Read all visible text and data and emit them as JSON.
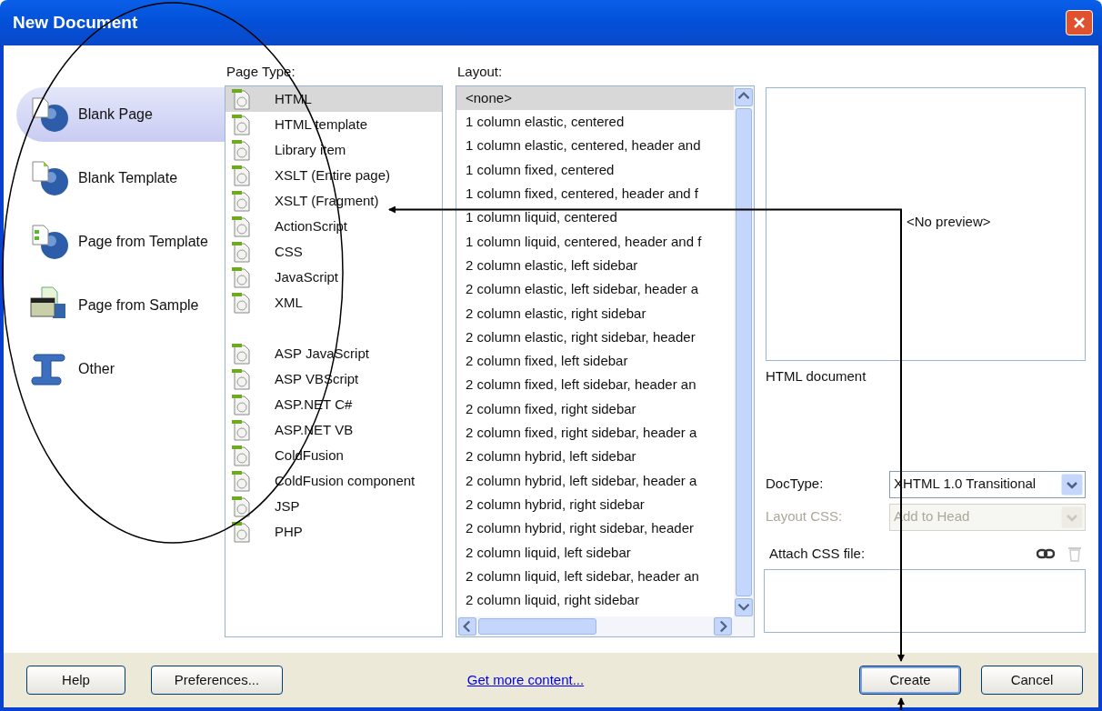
{
  "window": {
    "title": "New Document"
  },
  "categories": [
    {
      "label": "Blank Page",
      "selected": true,
      "kind": "blank-page"
    },
    {
      "label": "Blank Template",
      "selected": false,
      "kind": "blank-template"
    },
    {
      "label": "Page from Template",
      "selected": false,
      "kind": "page-template"
    },
    {
      "label": "Page from Sample",
      "selected": false,
      "kind": "page-sample"
    },
    {
      "label": "Other",
      "selected": false,
      "kind": "other"
    }
  ],
  "page_type": {
    "label": "Page Type:",
    "groups": [
      {
        "items": [
          {
            "label": "HTML",
            "selected": true
          },
          {
            "label": "HTML template",
            "selected": false
          },
          {
            "label": "Library item",
            "selected": false
          },
          {
            "label": "XSLT (Entire page)",
            "selected": false
          },
          {
            "label": "XSLT (Fragment)",
            "selected": false
          },
          {
            "label": "ActionScript",
            "selected": false
          },
          {
            "label": "CSS",
            "selected": false
          },
          {
            "label": "JavaScript",
            "selected": false
          },
          {
            "label": "XML",
            "selected": false
          }
        ]
      },
      {
        "items": [
          {
            "label": "ASP JavaScript",
            "selected": false
          },
          {
            "label": "ASP VBScript",
            "selected": false
          },
          {
            "label": "ASP.NET C#",
            "selected": false
          },
          {
            "label": "ASP.NET VB",
            "selected": false
          },
          {
            "label": "ColdFusion",
            "selected": false
          },
          {
            "label": "ColdFusion component",
            "selected": false
          },
          {
            "label": "JSP",
            "selected": false
          },
          {
            "label": "PHP",
            "selected": false
          }
        ]
      }
    ]
  },
  "layout": {
    "label": "Layout:",
    "items": [
      {
        "label": "<none>",
        "selected": true
      },
      {
        "label": "1 column elastic, centered",
        "selected": false
      },
      {
        "label": "1 column elastic, centered, header and",
        "selected": false
      },
      {
        "label": "1 column fixed, centered",
        "selected": false
      },
      {
        "label": "1 column fixed, centered, header and f",
        "selected": false
      },
      {
        "label": "1 column liquid, centered",
        "selected": false
      },
      {
        "label": "1 column liquid, centered, header and f",
        "selected": false
      },
      {
        "label": "2 column elastic, left sidebar",
        "selected": false
      },
      {
        "label": "2 column elastic, left sidebar, header a",
        "selected": false
      },
      {
        "label": "2 column elastic, right sidebar",
        "selected": false
      },
      {
        "label": "2 column elastic, right sidebar, header",
        "selected": false
      },
      {
        "label": "2 column fixed, left sidebar",
        "selected": false
      },
      {
        "label": "2 column fixed, left sidebar, header an",
        "selected": false
      },
      {
        "label": "2 column fixed, right sidebar",
        "selected": false
      },
      {
        "label": "2 column fixed, right sidebar, header a",
        "selected": false
      },
      {
        "label": "2 column hybrid, left sidebar",
        "selected": false
      },
      {
        "label": "2 column hybrid, left sidebar, header a",
        "selected": false
      },
      {
        "label": "2 column hybrid, right sidebar",
        "selected": false
      },
      {
        "label": "2 column hybrid, right sidebar, header",
        "selected": false
      },
      {
        "label": "2 column liquid, left sidebar",
        "selected": false
      },
      {
        "label": "2 column liquid, left sidebar, header an",
        "selected": false
      },
      {
        "label": "2 column liquid, right sidebar",
        "selected": false
      }
    ]
  },
  "preview": {
    "text": "<No preview>",
    "description": "HTML document"
  },
  "selects": [
    {
      "label": "DocType:",
      "value": "XHTML 1.0 Transitional",
      "disabled": false
    },
    {
      "label": "Layout CSS:",
      "value": "Add to Head",
      "disabled": true
    }
  ],
  "attach_css": {
    "label": "Attach CSS file:"
  },
  "footer": {
    "buttons_left": [
      "Help",
      "Preferences..."
    ],
    "link": "Get more content...",
    "buttons_right": [
      {
        "label": "Create",
        "default": true
      },
      {
        "label": "Cancel",
        "default": false
      }
    ]
  }
}
